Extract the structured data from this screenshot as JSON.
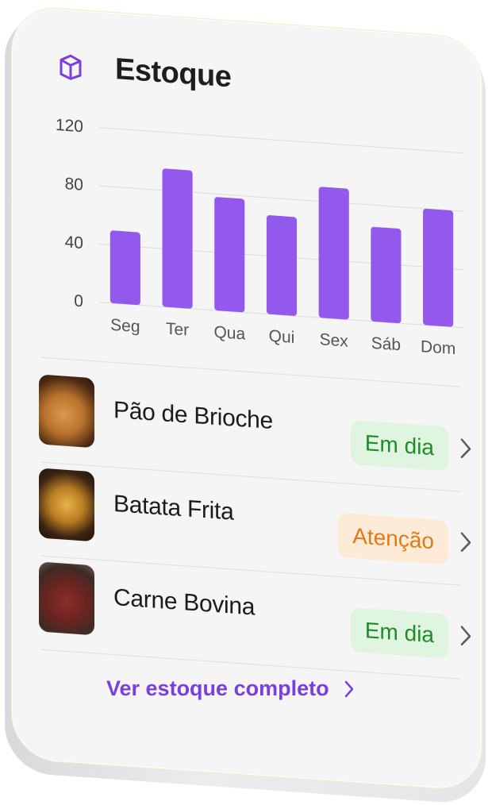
{
  "header": {
    "title": "Estoque",
    "icon": "package-box-icon",
    "accent": "#7b3fe0"
  },
  "chart_data": {
    "type": "bar",
    "categories": [
      "Seg",
      "Ter",
      "Qua",
      "Qui",
      "Sex",
      "Sáb",
      "Dom"
    ],
    "values": [
      50,
      95,
      78,
      68,
      90,
      65,
      80
    ],
    "yticks": [
      "0",
      "40",
      "80",
      "120"
    ],
    "ylim": [
      0,
      120
    ],
    "grid": true,
    "bar_color": "#9359ec"
  },
  "items": [
    {
      "name": "Pão de Brioche",
      "status": "Em dia",
      "status_type": "ok",
      "image": "brioche-bread-image"
    },
    {
      "name": "Batata Frita",
      "status": "Atenção",
      "status_type": "warn",
      "image": "french-fries-image"
    },
    {
      "name": "Carne Bovina",
      "status": "Em dia",
      "status_type": "ok",
      "image": "beef-meat-image"
    }
  ],
  "footer": {
    "link_label": "Ver estoque completo"
  },
  "colors": {
    "ok_text": "#1f8a2a",
    "ok_bg": "#dff5df",
    "warn_text": "#e07a17",
    "warn_bg": "#fdebd7"
  }
}
